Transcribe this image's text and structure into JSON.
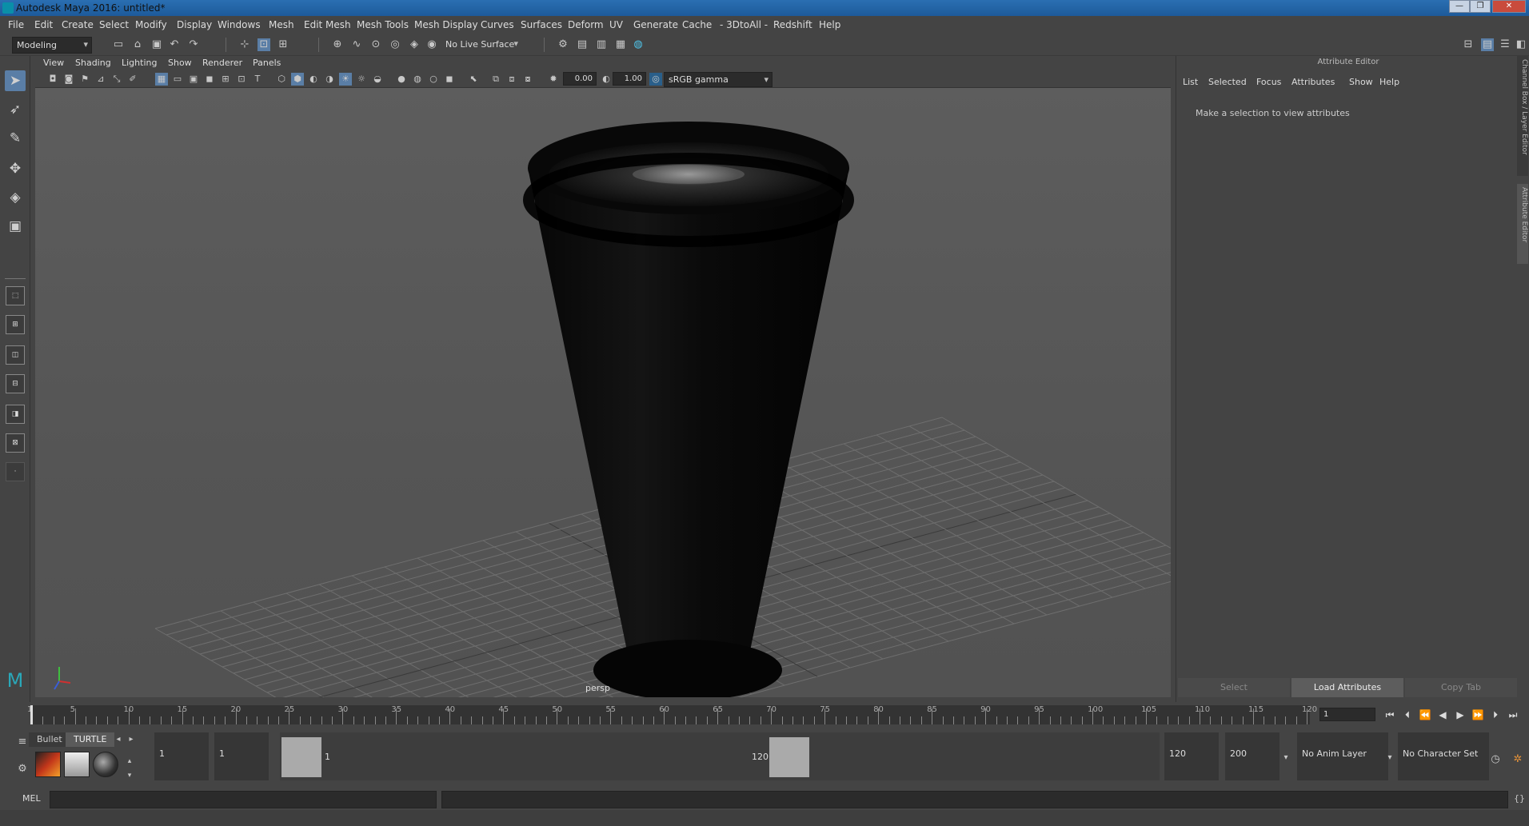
{
  "window": {
    "title": "Autodesk Maya 2016: untitled*",
    "controls": {
      "minimize": "—",
      "maximize": "❐",
      "close": "✕"
    }
  },
  "menubar": {
    "items": [
      "File",
      "Edit",
      "Create",
      "Select",
      "Modify",
      "Display",
      "Windows",
      "Mesh",
      "Edit Mesh",
      "Mesh Tools",
      "Mesh Display",
      "Curves",
      "Surfaces",
      "Deform",
      "UV",
      "Generate",
      "Cache",
      "- 3DtoAll -",
      "Redshift",
      "Help"
    ]
  },
  "statusline": {
    "mode": "Modeling",
    "live_surface": "No Live Surface"
  },
  "panel": {
    "menus": [
      "View",
      "Shading",
      "Lighting",
      "Show",
      "Renderer",
      "Panels"
    ],
    "exposure": "0.00",
    "gamma": "1.00",
    "color_space": "sRGB gamma",
    "camera": "persp"
  },
  "attribute_editor": {
    "header": "Attribute Editor",
    "menus": [
      "List",
      "Selected",
      "Focus",
      "Attributes",
      "Show",
      "Help"
    ],
    "message": "Make a selection to view attributes",
    "buttons": {
      "select": "Select",
      "load": "Load Attributes",
      "copy": "Copy Tab"
    },
    "side_tabs": {
      "channel_box": "Channel Box / Layer Editor",
      "attribute": "Attribute Editor"
    }
  },
  "timeslider": {
    "labels": [
      "1",
      "5",
      "10",
      "15",
      "20",
      "25",
      "30",
      "35",
      "40",
      "45",
      "50",
      "55",
      "60",
      "65",
      "70",
      "75",
      "80",
      "85",
      "90",
      "95",
      "100",
      "105",
      "110",
      "115",
      "120"
    ],
    "current_frame": "1"
  },
  "shelf": {
    "tabs": [
      "Bullet",
      "TURTLE"
    ]
  },
  "range": {
    "start_anim": "1",
    "start_play": "1",
    "range_start_label": "1",
    "range_end_label": "120",
    "end_play": "120",
    "end_anim": "200",
    "anim_layer": "No Anim Layer",
    "character_set": "No Character Set"
  },
  "cmdline": {
    "language": "MEL"
  },
  "colors": {
    "accent": "#5a7ea6",
    "titlebar": "#1d5a9a",
    "viewport_bg": "#5a5a5a"
  }
}
